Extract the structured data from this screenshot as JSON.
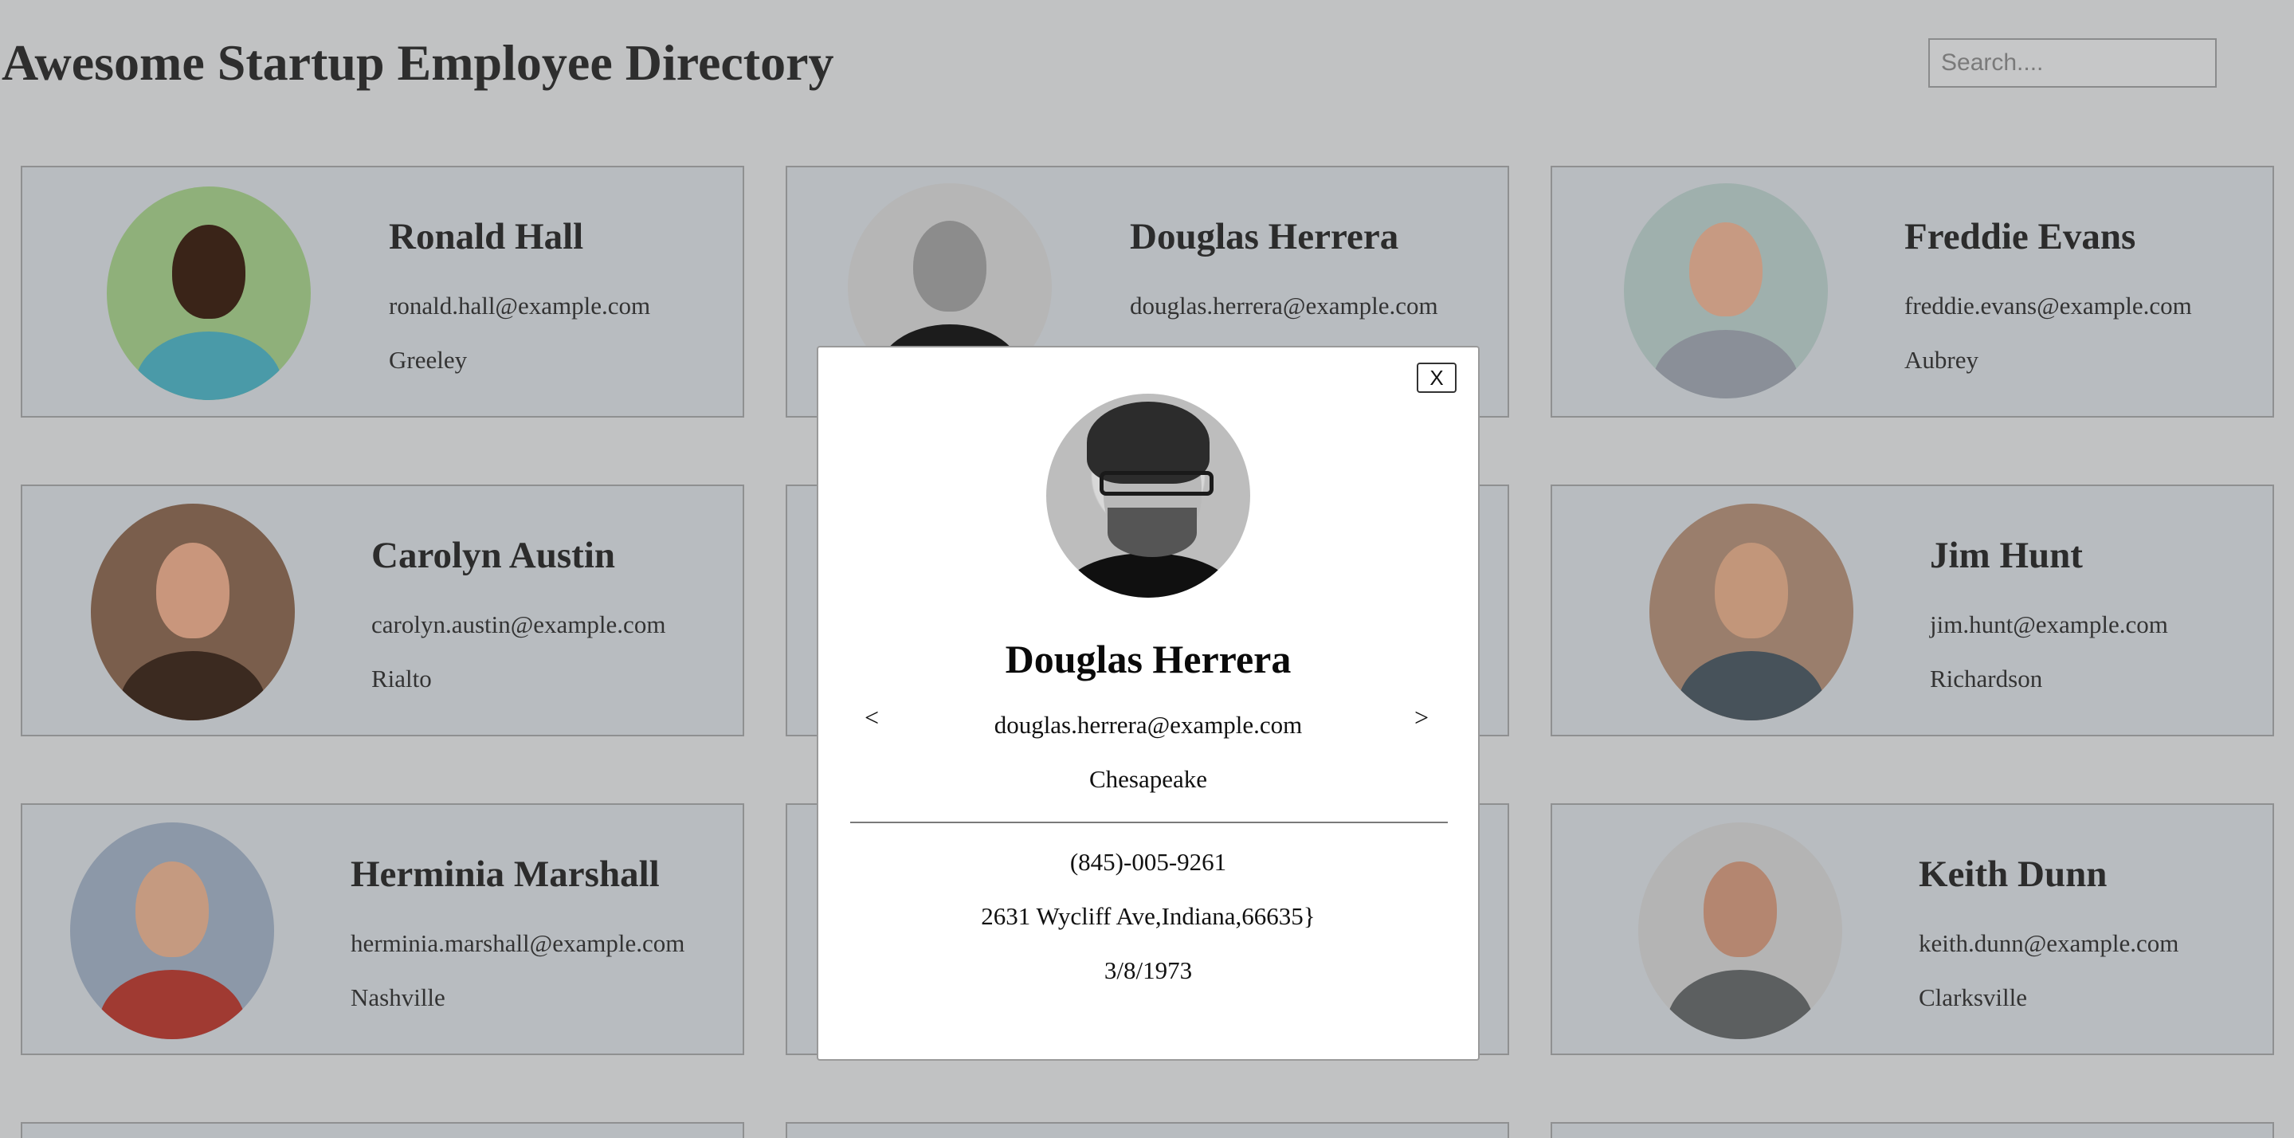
{
  "header": {
    "title": "Awesome Startup Employee Directory",
    "search_placeholder": "Search...."
  },
  "employees": [
    {
      "name": "Ronald Hall",
      "email": "ronald.hall@example.com",
      "city": "Greeley"
    },
    {
      "name": "Douglas Herrera",
      "email": "douglas.herrera@example.com",
      "city": ""
    },
    {
      "name": "Freddie Evans",
      "email": "freddie.evans@example.com",
      "city": "Aubrey"
    },
    {
      "name": "Carolyn Austin",
      "email": "carolyn.austin@example.com",
      "city": "Rialto"
    },
    {
      "name": "Jim Hunt",
      "email": "jim.hunt@example.com",
      "city": "Richardson"
    },
    {
      "name": "Herminia Marshall",
      "email": "herminia.marshall@example.com",
      "city": "Nashville"
    },
    {
      "name": "Keith Dunn",
      "email": "keith.dunn@example.com",
      "city": "Clarksville"
    }
  ],
  "modal": {
    "close_label": "X",
    "prev_label": "<",
    "next_label": ">",
    "name": "Douglas Herrera",
    "email": "douglas.herrera@example.com",
    "city": "Chesapeake",
    "phone": "(845)-005-9261",
    "address": "2631 Wycliff Ave,Indiana,66635}",
    "birthday": "3/8/1973"
  }
}
